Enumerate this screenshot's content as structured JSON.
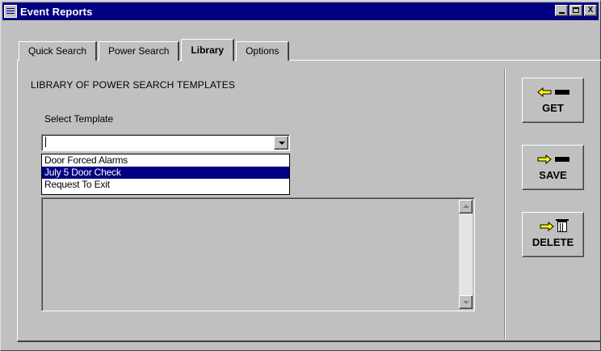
{
  "window": {
    "title": "Event Reports",
    "icon": "app-icon"
  },
  "titlebar_buttons": {
    "close_label": "X"
  },
  "tabs": [
    {
      "label": "Quick Search",
      "active": false
    },
    {
      "label": "Power Search",
      "active": false
    },
    {
      "label": "Library",
      "active": true
    },
    {
      "label": "Options",
      "active": false
    }
  ],
  "library": {
    "heading": "LIBRARY OF POWER SEARCH TEMPLATES",
    "select_label": "Select Template",
    "combo_value": "",
    "dropdown_items": [
      {
        "label": "Door Forced Alarms",
        "selected": false
      },
      {
        "label": "July 5 Door Check",
        "selected": true
      },
      {
        "label": "Request To Exit",
        "selected": false
      }
    ]
  },
  "actions": {
    "get_label": "GET",
    "save_label": "SAVE",
    "delete_label": "DELETE"
  },
  "colors": {
    "titlebar": "#000080",
    "face": "#c0c0c0",
    "selection": "#000080",
    "arrow_fill": "#ffff00"
  }
}
